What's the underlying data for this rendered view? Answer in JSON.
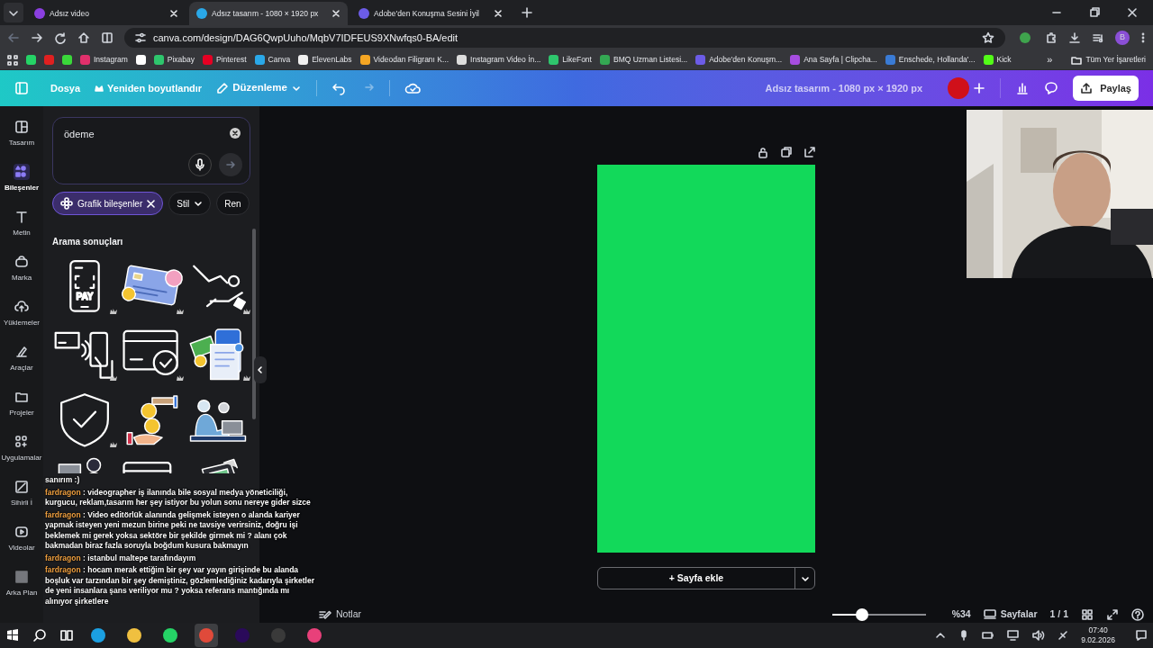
{
  "browser": {
    "tabs": [
      {
        "title": "Adsız video",
        "selected": false
      },
      {
        "title": "Adsız tasarım - 1080 × 1920 px",
        "selected": true
      },
      {
        "title": "Adobe'den Konuşma Sesini İyil",
        "selected": false
      }
    ],
    "url": "canva.com/design/DAG6QwpUuho/MqbV7IDFEUS9XNwfqs0-BA/edit",
    "bookmarks": [
      {
        "color": "#25d366"
      },
      {
        "color": "#e02020"
      },
      {
        "color": "#3ad83a"
      },
      {
        "label": "Instagram",
        "color": "#e1306c"
      },
      {
        "color": "#ffffff"
      },
      {
        "label": "Pixabay",
        "color": "#2ec66d"
      },
      {
        "label": "Pinterest",
        "color": "#e60023"
      },
      {
        "label": "Canva",
        "color": "#2aa8e8"
      },
      {
        "label": "ElevenLabs",
        "color": "#f0f0f0"
      },
      {
        "label": "Videodan Filigranı K...",
        "color": "#f5a623"
      },
      {
        "label": "Instagram Video İn...",
        "color": "#dddddd"
      },
      {
        "label": "LikeFont",
        "color": "#2ec66d"
      },
      {
        "label": "BMQ Uzman Listesi...",
        "color": "#34a853"
      },
      {
        "label": "Adobe'den Konuşm...",
        "color": "#6c5ce7"
      },
      {
        "label": "Ana Sayfa | Clipcha...",
        "color": "#a64de0"
      },
      {
        "label": "Enschede, Hollanda'...",
        "color": "#3a7bd5"
      },
      {
        "label": "Kick",
        "color": "#53fc18"
      }
    ],
    "more_bookmarks": "»",
    "all_bookmarks": "Tüm Yer İşaretleri",
    "profile": "B"
  },
  "header": {
    "menu": [
      {
        "label": "Dosya",
        "kind": "plain"
      },
      {
        "label": "Yeniden boyutlandır",
        "kind": "crown"
      },
      {
        "label": "Düzenleme",
        "kind": "dropdown"
      }
    ],
    "design_title": "Adsız tasarım - 1080 px × 1920 px",
    "share": "Paylaş"
  },
  "sidebar": [
    {
      "label": "Tasarım",
      "selected": false
    },
    {
      "label": "Bileşenler",
      "selected": true
    },
    {
      "label": "Metin",
      "selected": false
    },
    {
      "label": "Marka",
      "selected": false
    },
    {
      "label": "Yüklemeler",
      "selected": false
    },
    {
      "label": "Araçlar",
      "selected": false
    },
    {
      "label": "Projeler",
      "selected": false
    },
    {
      "label": "Uygulamalar",
      "selected": false
    },
    {
      "label": "Sihirli İ",
      "selected": false
    },
    {
      "label": "Videolar",
      "selected": false
    },
    {
      "label": "Arka Plan",
      "selected": false
    }
  ],
  "search": {
    "value": "ödeme"
  },
  "filters": [
    {
      "label": "Grafik bileşenler",
      "kind": "active"
    },
    {
      "label": "Stil",
      "kind": "dropdown"
    },
    {
      "label": "Ren",
      "kind": "plain"
    }
  ],
  "results_title": "Arama sonuçları",
  "results": [
    {
      "kind": "phone",
      "text": "PAY",
      "premium": true
    },
    {
      "kind": "card",
      "premium": true
    },
    {
      "kind": "hand",
      "premium": true
    },
    {
      "kind": "contactless",
      "premium": true
    },
    {
      "kind": "cardcheck",
      "premium": true
    },
    {
      "kind": "receipt",
      "premium": true
    },
    {
      "kind": "shield",
      "premium": true
    },
    {
      "kind": "coins",
      "premium": false
    },
    {
      "kind": "person",
      "premium": false
    },
    {
      "kind": "woman",
      "premium": false
    },
    {
      "kind": "card2",
      "premium": false
    },
    {
      "kind": "pos",
      "premium": false
    }
  ],
  "canvas": {
    "add_page": "+ Sayfa ekle"
  },
  "footer": {
    "notes": "Notlar",
    "zoom": {
      "level": 0.32
    },
    "zoom_text": "%34",
    "pages": "Sayfalar",
    "page_count": "1 / 1"
  },
  "chat": [
    {
      "text": "sanırım :)"
    },
    {
      "user": "fardragon",
      "text": ": videographer iş ilanında bile sosyal medya yöneticiliği, kurgucu, reklam,tasarım her şey istiyor bu yolun sonu nereye gider sizce"
    },
    {
      "user": "fardragon",
      "text": ": Video editörlük alanında gelişmek isteyen o alanda kariyer yapmak isteyen yeni mezun birine peki ne tavsiye verirsiniz, doğru işi beklemek mi gerek yoksa sektöre bir şekilde girmek mi ? alanı çok bakmadan biraz fazla soruyla boğdum kusura bakmayın"
    },
    {
      "user": "fardragon",
      "text": ": istanbul maltepe tarafındayım"
    },
    {
      "user": "fardragon",
      "text": ": hocam merak ettiğim bir şey var yayın girişinde bu alanda boşluk var tarzından bir şey demiştiniz, gözlemlediğiniz kadarıyla şirketler de yeni insanlara şans veriliyor mu ? yoksa referans mantığında mı alınıyor şirketlere"
    }
  ],
  "taskbar": {
    "apps": [
      {
        "kind": "edge",
        "selected": false
      },
      {
        "kind": "files",
        "selected": false
      },
      {
        "kind": "whatsapp",
        "selected": false
      },
      {
        "kind": "chrome",
        "selected": true
      },
      {
        "kind": "premiere",
        "selected": false
      },
      {
        "kind": "obs",
        "selected": false
      },
      {
        "kind": "cc",
        "selected": false
      }
    ],
    "time": "07:40",
    "date": "9.02.2026"
  }
}
